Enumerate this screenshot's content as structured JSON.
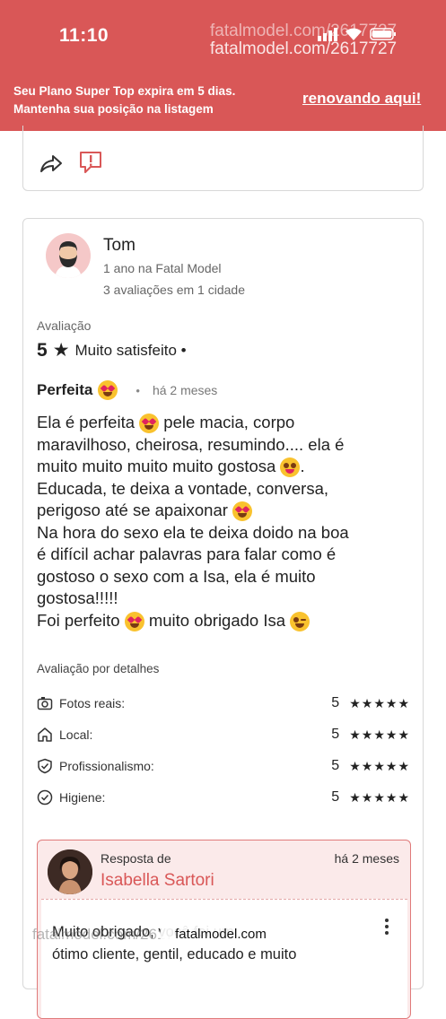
{
  "status_bar": {
    "time": "11:10"
  },
  "watermark": {
    "line1": "fatalmodel.com/2617727",
    "line2": "fatalmodel.com/2617727",
    "bottom": "fatalmodel.com/2617727",
    "pill": "fatalmodel.com"
  },
  "plan_banner": {
    "line1": "Seu Plano Super Top expira em 5 dias.",
    "line2": "Mantenha sua posição na listagem",
    "link": "renovando aqui!"
  },
  "review": {
    "user_name": "Tom",
    "user_since": "1 ano na Fatal Model",
    "user_reviews": "3 avaliações em 1 cidade",
    "rating_label": "Avaliação",
    "rating_value": "5",
    "rating_text": "Muito satisfeito •",
    "title": "Perfeita",
    "date": "há 2 meses",
    "body_lines": [
      "Ela é perfeita",
      "pele macia, corpo",
      "maravilhoso, cheirosa, resumindo.... ela é",
      "muito muito muito muito gostosa",
      "Educada, te deixa a vontade, conversa,",
      "perigoso até se apaixonar",
      "Na hora do sexo ela te deixa doido na boa",
      "é difícil achar palavras para falar como é",
      "gostoso o sexo com a Isa, ela é muito",
      "gostosa!!!!!",
      "Foi perfeito",
      "muito obrigado Isa"
    ],
    "details_label": "Avaliação por detalhes",
    "details": [
      {
        "icon": "camera-icon",
        "label": "Fotos reais:",
        "score": "5",
        "stars": "★★★★★"
      },
      {
        "icon": "home-icon",
        "label": "Local:",
        "score": "5",
        "stars": "★★★★★"
      },
      {
        "icon": "shield-check-icon",
        "label": "Profissionalismo:",
        "score": "5",
        "stars": "★★★★★"
      },
      {
        "icon": "check-circle-icon",
        "label": "Higiene:",
        "score": "5",
        "stars": "★★★★★"
      }
    ]
  },
  "reply": {
    "label": "Resposta de",
    "date": "há 2 meses",
    "name": "Isabella Sartori",
    "text_line1": "Muito obrigado, você foi um",
    "text_line2": "ótimo cliente, gentil, educado e muito"
  },
  "colors": {
    "brand": "#d95757",
    "reply_bg": "#fbeaea"
  }
}
